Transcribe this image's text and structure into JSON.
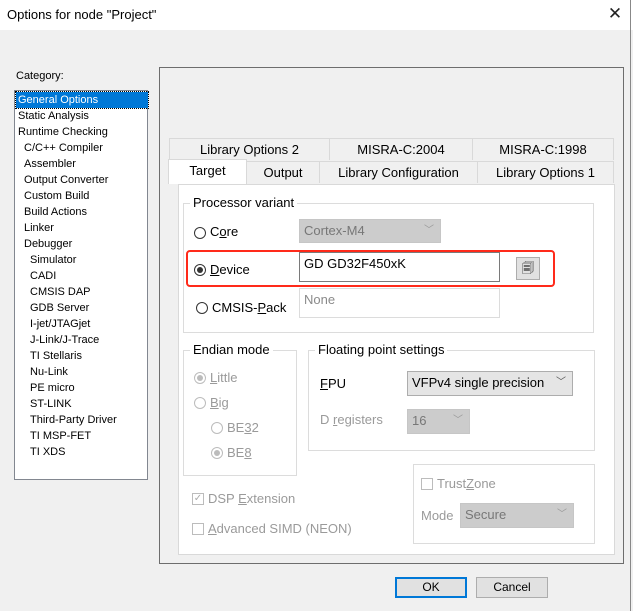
{
  "window": {
    "title": "Options for node \"Project\"",
    "close_icon": "✕"
  },
  "category": {
    "label": "Category:",
    "items": [
      {
        "label": "General Options",
        "level": 0,
        "selected": true
      },
      {
        "label": "Static Analysis",
        "level": 0
      },
      {
        "label": "Runtime Checking",
        "level": 0
      },
      {
        "label": "C/C++ Compiler",
        "level": 1
      },
      {
        "label": "Assembler",
        "level": 1
      },
      {
        "label": "Output Converter",
        "level": 1
      },
      {
        "label": "Custom Build",
        "level": 1
      },
      {
        "label": "Build Actions",
        "level": 1
      },
      {
        "label": "Linker",
        "level": 1
      },
      {
        "label": "Debugger",
        "level": 1
      },
      {
        "label": "Simulator",
        "level": 2
      },
      {
        "label": "CADI",
        "level": 2
      },
      {
        "label": "CMSIS DAP",
        "level": 2
      },
      {
        "label": "GDB Server",
        "level": 2
      },
      {
        "label": "I-jet/JTAGjet",
        "level": 2
      },
      {
        "label": "J-Link/J-Trace",
        "level": 2
      },
      {
        "label": "TI Stellaris",
        "level": 2
      },
      {
        "label": "Nu-Link",
        "level": 2
      },
      {
        "label": "PE micro",
        "level": 2
      },
      {
        "label": "ST-LINK",
        "level": 2
      },
      {
        "label": "Third-Party Driver",
        "level": 2
      },
      {
        "label": "TI MSP-FET",
        "level": 2
      },
      {
        "label": "TI XDS",
        "level": 2
      }
    ]
  },
  "tabs": {
    "row1": [
      "Library Options 2",
      "MISRA-C:2004",
      "MISRA-C:1998"
    ],
    "row2": [
      "Target",
      "Output",
      "Library Configuration",
      "Library Options 1"
    ],
    "active": "Target"
  },
  "processor_variant": {
    "label": "Processor variant",
    "core": {
      "label_pre": "C",
      "label_u": "o",
      "label_post": "re",
      "selected": false,
      "value": "Cortex-M4"
    },
    "device": {
      "label_u": "D",
      "label_post": "evice",
      "selected": true,
      "value": "GD GD32F450xK",
      "browse_icon": "device-select-icon"
    },
    "cmsis_pack": {
      "label_pre": "CMSIS-",
      "label_u": "P",
      "label_post": "ack",
      "selected": false,
      "value": "None"
    }
  },
  "endian_mode": {
    "label": "Endian mode",
    "little": {
      "u": "L",
      "post": "ittle",
      "selected": true
    },
    "big": {
      "u": "B",
      "post": "ig",
      "selected": false
    },
    "be32": {
      "pre": "BE",
      "u": "3",
      "post": "2",
      "selected": false
    },
    "be8": {
      "pre": "BE",
      "u": "8",
      "post": "",
      "selected": true
    }
  },
  "floating_point": {
    "label": "Floating point settings",
    "fpu": {
      "u": "F",
      "post": "PU",
      "value": "VFPv4 single precision"
    },
    "d_registers": {
      "pre": "D ",
      "u": "r",
      "post": "egisters",
      "value": "16"
    }
  },
  "dsp_extension": {
    "pre": "DSP ",
    "u": "E",
    "post": "xtension",
    "checked": true
  },
  "advanced_simd": {
    "u": "A",
    "post": "dvanced SIMD (NEON)",
    "checked": false
  },
  "trustzone": {
    "pre": "Trust",
    "u": "Z",
    "post": "one",
    "checked": false,
    "mode_label": "Mode",
    "mode_value": "Secure"
  },
  "buttons": {
    "ok": "OK",
    "cancel": "Cancel"
  },
  "colors": {
    "selection": "#0078d7",
    "highlight_box": "#ff2a1a"
  }
}
